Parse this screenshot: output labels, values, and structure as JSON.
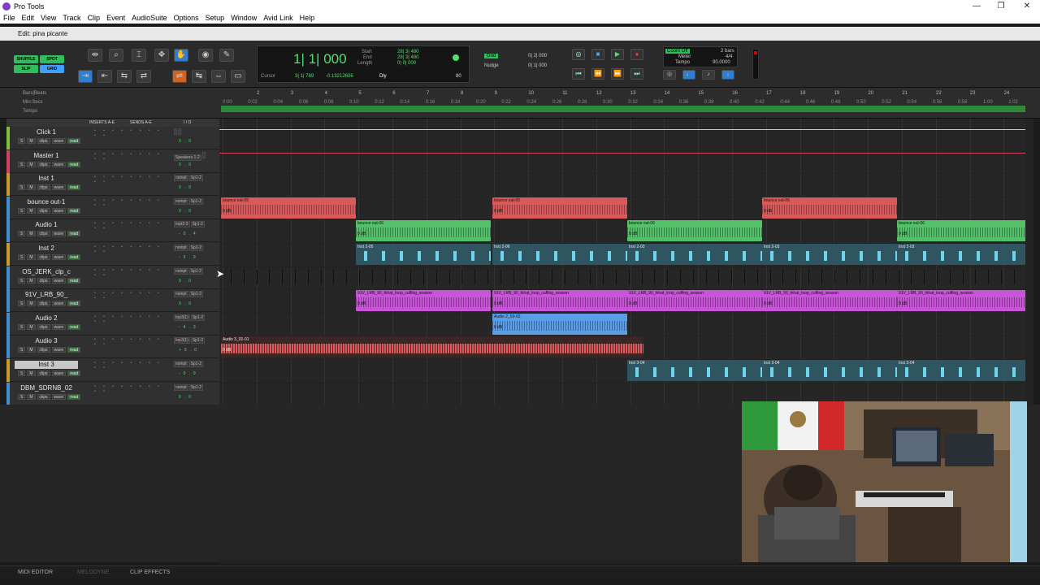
{
  "app": {
    "title": "Pro Tools"
  },
  "window_controls": {
    "minimize": "—",
    "maximize": "❐",
    "close": "✕"
  },
  "menu": [
    "File",
    "Edit",
    "View",
    "Track",
    "Clip",
    "Event",
    "AudioSuite",
    "Options",
    "Setup",
    "Window",
    "Avid Link",
    "Help"
  ],
  "edit_window": {
    "title": "Edit: pina picante"
  },
  "edit_modes": {
    "shuffle": "SHUFFLE",
    "spot": "SPOT",
    "slip": "SLIP",
    "grid": "GRID"
  },
  "counter": {
    "main": "1| 1| 000",
    "start_label": "Start",
    "end_label": "End",
    "length_label": "Length",
    "start": "28| 3| 480",
    "end": "28| 3| 480",
    "length": "0| 0| 000",
    "cursor_label": "Cursor",
    "cursor": "3| 1| 789",
    "cursor_db": "-0.13212606",
    "dly": "Dly",
    "value_80": "80"
  },
  "grid_nudge": {
    "grid_label": "Grid",
    "grid_value": "0| 2| 000",
    "nudge_label": "Nudge",
    "nudge_value": "0| 1| 000"
  },
  "count_off": {
    "count_off": "Count Off",
    "meter_label": "Meter",
    "meter_value": "4/4",
    "tempo_label": "Tempo",
    "tempo_value": "90.0000",
    "bars": "2 bars"
  },
  "rulers": {
    "bars_beats": "Bars|Beats",
    "min_secs": "Min:Secs",
    "tempo": "Tempo"
  },
  "bar_numbers": [
    "2",
    "3",
    "4",
    "5",
    "6",
    "7",
    "8",
    "9",
    "10",
    "11",
    "12",
    "13",
    "14",
    "15",
    "16",
    "17",
    "18",
    "19",
    "20",
    "21",
    "22",
    "23",
    "24"
  ],
  "time_labels": [
    "0:00",
    "0:02",
    "0:04",
    "0:06",
    "0:08",
    "0:10",
    "0:12",
    "0:14",
    "0:16",
    "0:18",
    "0:20",
    "0:22",
    "0:24",
    "0:26",
    "0:28",
    "0:30",
    "0:32",
    "0:34",
    "0:36",
    "0:38",
    "0:40",
    "0:42",
    "0:44",
    "0:46",
    "0:48",
    "0:50",
    "0:52",
    "0:54",
    "0:56",
    "0:58",
    "1:00",
    "1:02"
  ],
  "track_header": {
    "inserts": "INSERTS A-E",
    "sends": "SENDS A-E",
    "io": "I / O"
  },
  "tracks": [
    {
      "name": "Click 1",
      "color": "#7fbf3f",
      "io_in": "",
      "io_out": "",
      "vol": "0.0"
    },
    {
      "name": "Master 1",
      "color": "#d04060",
      "io_in": "Speakers 1-2",
      "io_out": "",
      "vol": "0.0"
    },
    {
      "name": "Inst 1",
      "color": "#c79a2e",
      "io_in": "noinpt",
      "io_out": "Sp1-2",
      "vol": "0.0"
    },
    {
      "name": "bounce out-1",
      "color": "#3f8fd0",
      "io_in": "noinpt",
      "io_out": "Sp1-2",
      "vol": "0.0"
    },
    {
      "name": "Audio 1",
      "color": "#3f8fd0",
      "io_in": "Inpt2-3",
      "io_out": "Sp1-2",
      "vol": "-0.4"
    },
    {
      "name": "Inst 2",
      "color": "#c79a2e",
      "io_in": "noinpt",
      "io_out": "Sp1-2",
      "vol": "-5.9"
    },
    {
      "name": "OS_JERK_clp_c",
      "color": "#3f8fd0",
      "io_in": "noinpt",
      "io_out": "Sp1-2",
      "vol": "0.0"
    },
    {
      "name": "91V_LRB_90_",
      "color": "#3f8fd0",
      "io_in": "noinpt",
      "io_out": "Sp1-2",
      "vol": "0.0"
    },
    {
      "name": "Audio 2",
      "color": "#3f8fd0",
      "io_in": "Inp3(1)",
      "io_out": "Sp1-2",
      "vol": "-4.3"
    },
    {
      "name": "Audio 3",
      "color": "#3f8fd0",
      "io_in": "Inp3(1)",
      "io_out": "Sp1-2",
      "vol": "+5.0"
    },
    {
      "name": "Inst 3",
      "color": "#c79a2e",
      "io_in": "noinpt",
      "io_out": "Sp1-2",
      "vol": "-0.9"
    },
    {
      "name": "DBM_SDRNB_02",
      "color": "#3f8fd0",
      "io_in": "noinpt",
      "io_out": "Sp1-2",
      "vol": "0.0"
    }
  ],
  "track_controls": {
    "s": "S",
    "m": "M",
    "wave": "wave",
    "read": "read",
    "vol": "vol",
    "clips": "clips",
    "volume": "volume"
  },
  "clips": {
    "bounce": "bounce out-05",
    "bounce2": "bounce out-06",
    "inst2_05": "Inst 2-05",
    "inst2_06": "Inst 2-06",
    "inst2_03": "Inst 2-03",
    "loop": "91V_LRB_90_hihat_loop_cuffing_season",
    "audio2": "Audio 2_03-02",
    "audio3": "Audio 3_01-01",
    "inst3_04": "Inst 3-04",
    "db": "0 dB"
  },
  "bottom_tabs": {
    "midi_editor": "MIDI EDITOR",
    "melodyne": "MELODYNE",
    "clip_effects": "CLIP EFFECTS"
  },
  "colors": {
    "green_clip": "#55c06a",
    "red_clip": "#d85a5a",
    "purple_clip": "#c855d8",
    "blue_clip": "#5a9ee8",
    "teal_clip": "#2f5560"
  }
}
